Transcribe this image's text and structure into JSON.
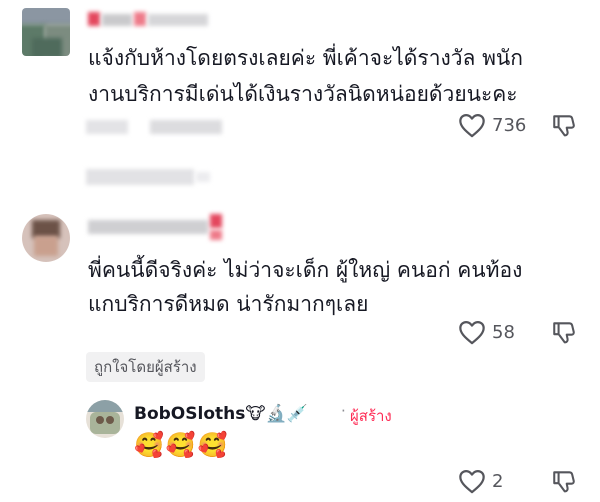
{
  "comments": [
    {
      "text_lines": [
        "แจ้งกับห้างโดยตรงเลยค่ะ พี่เค้าจะได้รางวัล พนัก",
        "งานบริการมีเด่นได้เงินรางวัลนิดหน่อยด้วยนะคะ"
      ],
      "likes": "736"
    },
    {
      "text_lines": [
        "พี่คนนี้ดีจริงค่ะ ไม่ว่าจะเด็ก ผู้ใหญ่ คนอก่ คนท้อง",
        "แกบริการดีหมด น่ารักมากๆเลย"
      ],
      "likes": "58",
      "creator_liked": "ถูกใจโดยผู้สร้าง"
    }
  ],
  "reply": {
    "username": "BobOSloths",
    "name_emojis": "🐮🔬💉",
    "separator": "·",
    "creator_label": "ผู้สร้าง",
    "text": "🥰🥰🥰",
    "likes": "2"
  },
  "colors": {
    "text": "#161823",
    "secondary": "#55565c",
    "creator": "#fe2c55",
    "pill": "#f1f1f2"
  },
  "icons": [
    "heart-outline-icon",
    "thumbs-down-icon"
  ]
}
